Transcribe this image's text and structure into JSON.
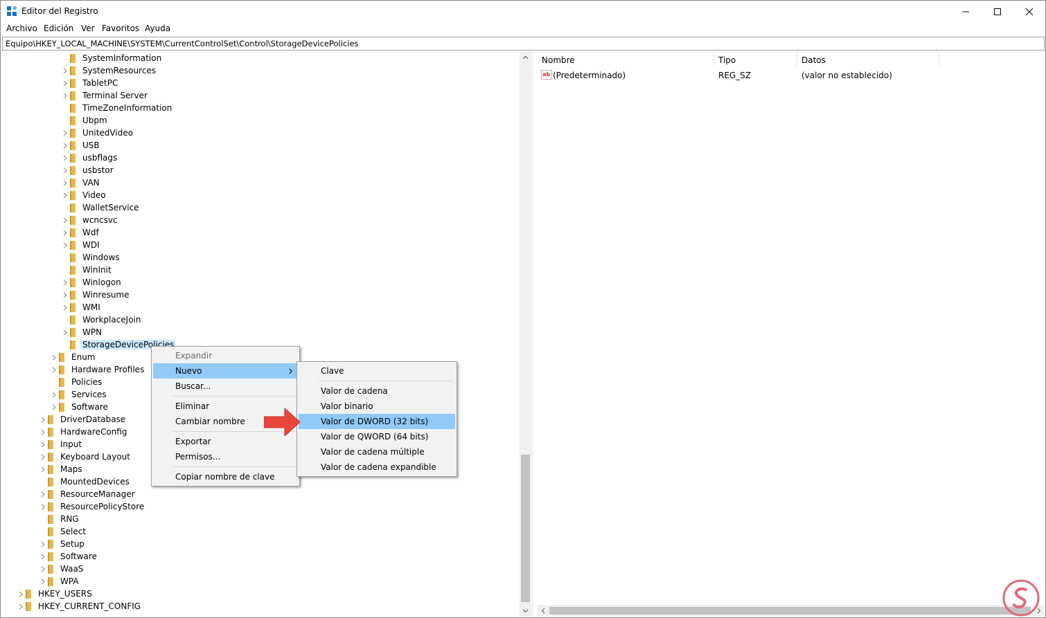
{
  "window": {
    "title": "Editor del Registro"
  },
  "menu": [
    "Archivo",
    "Edición",
    "Ver",
    "Favoritos",
    "Ayuda"
  ],
  "address": "Equipo\\HKEY_LOCAL_MACHINE\\SYSTEM\\CurrentControlSet\\Control\\StorageDevicePolicies",
  "tree": [
    {
      "label": "SystemInformation",
      "expandable": false
    },
    {
      "label": "SystemResources",
      "expandable": true
    },
    {
      "label": "TabletPC",
      "expandable": true
    },
    {
      "label": "Terminal Server",
      "expandable": true
    },
    {
      "label": "TimeZoneInformation",
      "expandable": false
    },
    {
      "label": "Ubpm",
      "expandable": false
    },
    {
      "label": "UnitedVideo",
      "expandable": true
    },
    {
      "label": "USB",
      "expandable": true
    },
    {
      "label": "usbflags",
      "expandable": true
    },
    {
      "label": "usbstor",
      "expandable": true
    },
    {
      "label": "VAN",
      "expandable": true
    },
    {
      "label": "Video",
      "expandable": true
    },
    {
      "label": "WalletService",
      "expandable": false
    },
    {
      "label": "wcncsvc",
      "expandable": true
    },
    {
      "label": "Wdf",
      "expandable": true
    },
    {
      "label": "WDI",
      "expandable": true
    },
    {
      "label": "Windows",
      "expandable": false
    },
    {
      "label": "WinInit",
      "expandable": false
    },
    {
      "label": "Winlogon",
      "expandable": true
    },
    {
      "label": "Winresume",
      "expandable": true
    },
    {
      "label": "WMI",
      "expandable": true
    },
    {
      "label": "WorkplaceJoin",
      "expandable": false
    },
    {
      "label": "WPN",
      "expandable": true
    },
    {
      "label": "StorageDevicePolicies",
      "expandable": false,
      "selected": true
    },
    {
      "label": "Enum",
      "expandable": true
    },
    {
      "label": "Hardware Profiles",
      "expandable": true
    },
    {
      "label": "Policies",
      "expandable": false
    },
    {
      "label": "Services",
      "expandable": true
    },
    {
      "label": "Software",
      "expandable": true
    },
    {
      "label": "DriverDatabase",
      "expandable": true
    },
    {
      "label": "HardwareConfig",
      "expandable": true
    },
    {
      "label": "Input",
      "expandable": true
    },
    {
      "label": "Keyboard Layout",
      "expandable": true
    },
    {
      "label": "Maps",
      "expandable": true
    },
    {
      "label": "MountedDevices",
      "expandable": false
    },
    {
      "label": "ResourceManager",
      "expandable": true
    },
    {
      "label": "ResourcePolicyStore",
      "expandable": true
    },
    {
      "label": "RNG",
      "expandable": false
    },
    {
      "label": "Select",
      "expandable": false
    },
    {
      "label": "Setup",
      "expandable": true
    },
    {
      "label": "Software",
      "expandable": true
    },
    {
      "label": "WaaS",
      "expandable": true
    },
    {
      "label": "WPA",
      "expandable": true
    },
    {
      "label": "HKEY_USERS",
      "expandable": true
    },
    {
      "label": "HKEY_CURRENT_CONFIG",
      "expandable": true
    }
  ],
  "columns": {
    "name": "Nombre",
    "type": "Tipo",
    "data": "Datos"
  },
  "values": [
    {
      "name": "(Predeterminado)",
      "type": "REG_SZ",
      "data": "(valor no establecido)"
    }
  ],
  "context_menu": {
    "expand": "Expandir",
    "new": "Nuevo",
    "find": "Buscar...",
    "delete": "Eliminar",
    "rename": "Cambiar nombre",
    "export": "Exportar",
    "permissions": "Permisos...",
    "copy_key": "Copiar nombre de clave"
  },
  "submenu": {
    "key": "Clave",
    "string": "Valor de cadena",
    "binary": "Valor binario",
    "dword": "Valor de DWORD (32 bits)",
    "qword": "Valor de QWORD (64 bits)",
    "multi_string": "Valor de cadena múltiple",
    "expandable_string": "Valor de cadena expandible"
  },
  "colors": {
    "folder": "#e8b84a",
    "highlight": "#91c9f7",
    "selection": "#cce8ff",
    "arrow": "#e8453c",
    "watermark": "#e0687a"
  }
}
